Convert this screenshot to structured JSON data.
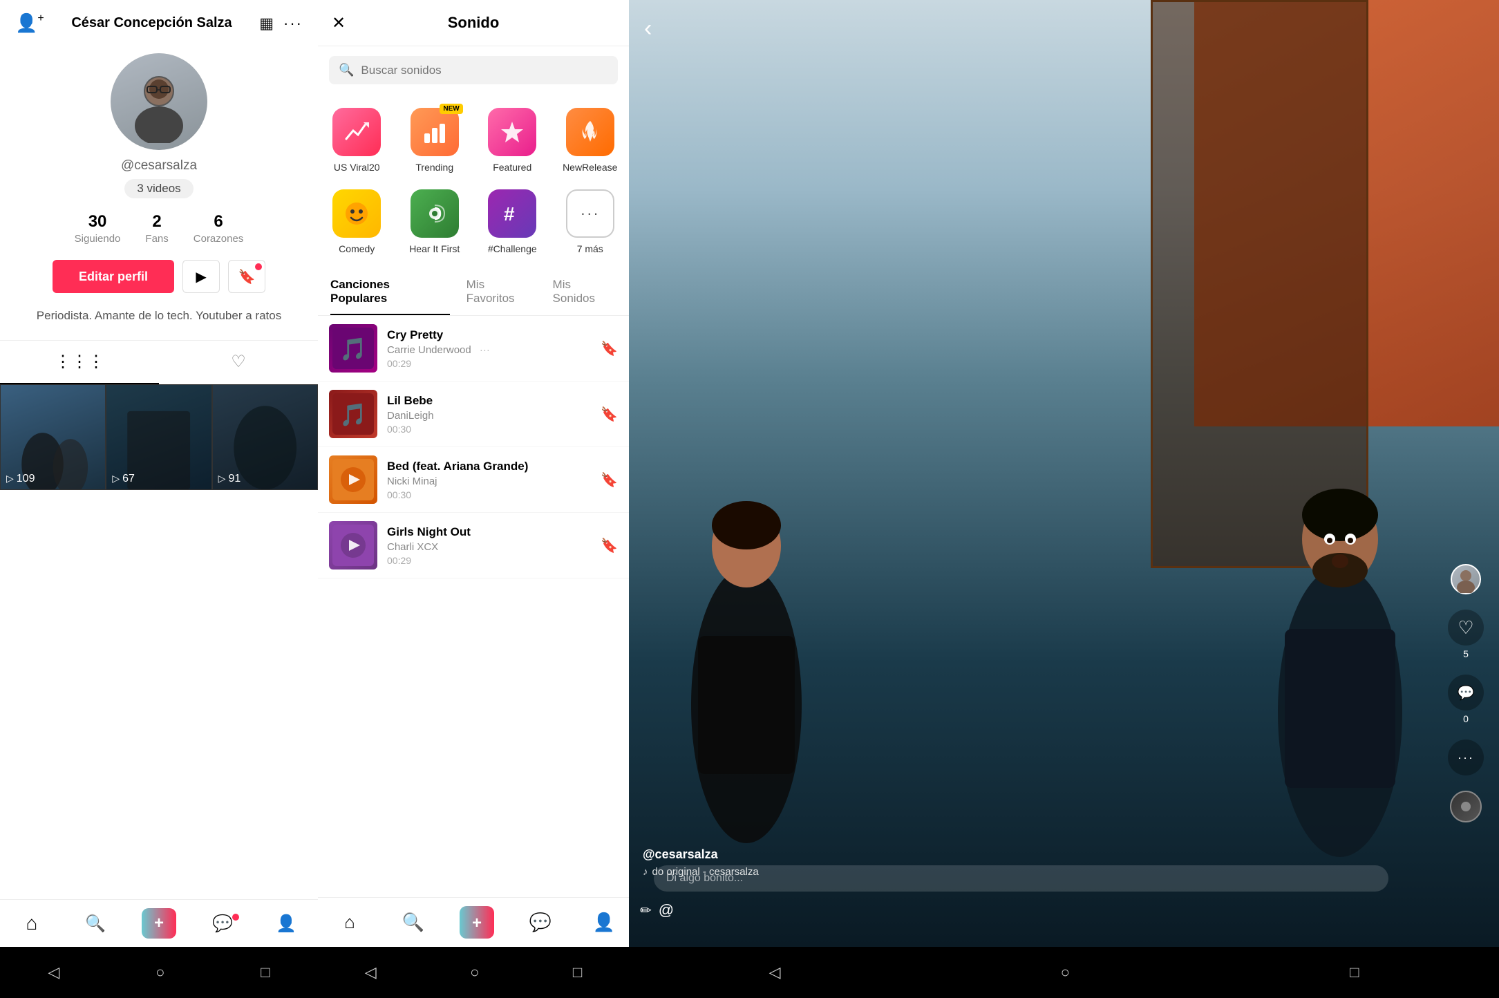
{
  "profile": {
    "name": "César Concepción Salza",
    "username": "@cesarsalza",
    "videos_count": "3 videos",
    "stats": {
      "following": "30",
      "following_label": "Siguiendo",
      "fans": "2",
      "fans_label": "Fans",
      "hearts": "6",
      "hearts_label": "Corazones"
    },
    "edit_button": "Editar perfil",
    "bio": "Periodista. Amante de lo tech. Youtuber a ratos"
  },
  "sounds": {
    "title": "Sonido",
    "search_placeholder": "Buscar sonidos",
    "categories": [
      {
        "id": "viral",
        "label": "US Viral20",
        "icon": "📈",
        "new": false
      },
      {
        "id": "trending",
        "label": "Trending",
        "icon": "📊",
        "new": true
      },
      {
        "id": "featured",
        "label": "Featured",
        "icon": "⭐",
        "new": false
      },
      {
        "id": "newrelease",
        "label": "NewRelease",
        "icon": "🔥",
        "new": false
      },
      {
        "id": "comedy",
        "label": "Comedy",
        "icon": "😂",
        "new": false
      },
      {
        "id": "hearitfirst",
        "label": "Hear It First",
        "icon": "🎵",
        "new": false
      },
      {
        "id": "challenge",
        "label": "#Challenge",
        "icon": "#️⃣",
        "new": false
      },
      {
        "id": "more",
        "label": "7 más",
        "icon": "···",
        "new": false
      }
    ],
    "tabs": [
      {
        "id": "popular",
        "label": "Canciones Populares",
        "active": true
      },
      {
        "id": "favorites",
        "label": "Mis Favoritos",
        "active": false
      },
      {
        "id": "mysounds",
        "label": "Mis Sonidos",
        "active": false
      }
    ],
    "songs": [
      {
        "id": "cry-pretty",
        "title": "Cry Pretty",
        "artist": "Carrie Underwood",
        "duration": "00:29",
        "thumb_class": "cry"
      },
      {
        "id": "lil-bebe",
        "title": "Lil Bebe",
        "artist": "DaniLeigh",
        "duration": "00:30",
        "thumb_class": "lil"
      },
      {
        "id": "bed",
        "title": "Bed (feat. Ariana Grande)",
        "artist": "Nicki Minaj",
        "duration": "00:30",
        "thumb_class": "bed"
      },
      {
        "id": "girls-night-out",
        "title": "Girls Night Out",
        "artist": "Charli XCX",
        "duration": "00:29",
        "thumb_class": "girls"
      }
    ]
  },
  "video": {
    "username": "@cesarsalza",
    "sound": "do original - cesarsalza",
    "likes": "5",
    "comments": "0",
    "comment_placeholder": "Di algo bonito..."
  },
  "nav": {
    "home_icon": "⌂",
    "search_icon": "🔍",
    "plus_icon": "+",
    "messages_icon": "💬",
    "profile_icon": "👤",
    "back_icon": "‹",
    "grid_icon": "▦",
    "more_icon": "···"
  },
  "android_nav": {
    "back": "◁",
    "home": "○",
    "square": "□"
  },
  "video_thumbnails": [
    {
      "count": "109"
    },
    {
      "count": "67"
    },
    {
      "count": "91"
    }
  ]
}
